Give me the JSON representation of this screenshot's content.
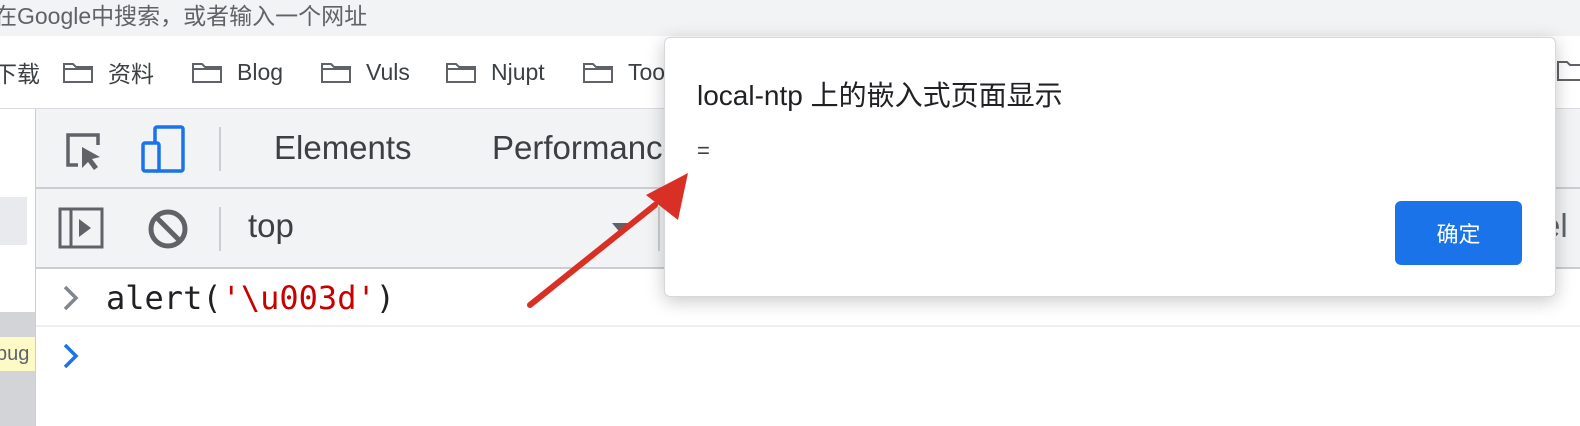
{
  "omnibox": {
    "placeholder": "在Google中搜索，或者输入一个网址"
  },
  "bookmarks": {
    "items": [
      {
        "label": "下载",
        "icon": "folder-icon"
      },
      {
        "label": "资料",
        "icon": "folder-icon"
      },
      {
        "label": "Blog",
        "icon": "folder-icon"
      },
      {
        "label": "Vuls",
        "icon": "folder-icon"
      },
      {
        "label": "Njupt",
        "icon": "folder-icon"
      },
      {
        "label": "Too",
        "icon": "folder-icon"
      }
    ]
  },
  "page_left": {
    "yellow_tag": "bug"
  },
  "devtools": {
    "tabs": [
      {
        "label": "Elements"
      },
      {
        "label": "Performance"
      }
    ],
    "device_toolbar_active": true,
    "context": "top",
    "filter_peek": "el",
    "console": {
      "command": {
        "prefix": "alert(",
        "string": "'\\u003d'",
        "suffix": ")"
      }
    }
  },
  "alert": {
    "title": "local-ntp 上的嵌入式页面显示",
    "message": "=",
    "ok_label": "确定"
  },
  "colors": {
    "accent_blue": "#1a73e8",
    "annotation_red": "#d93025",
    "string_red": "#c80000"
  }
}
